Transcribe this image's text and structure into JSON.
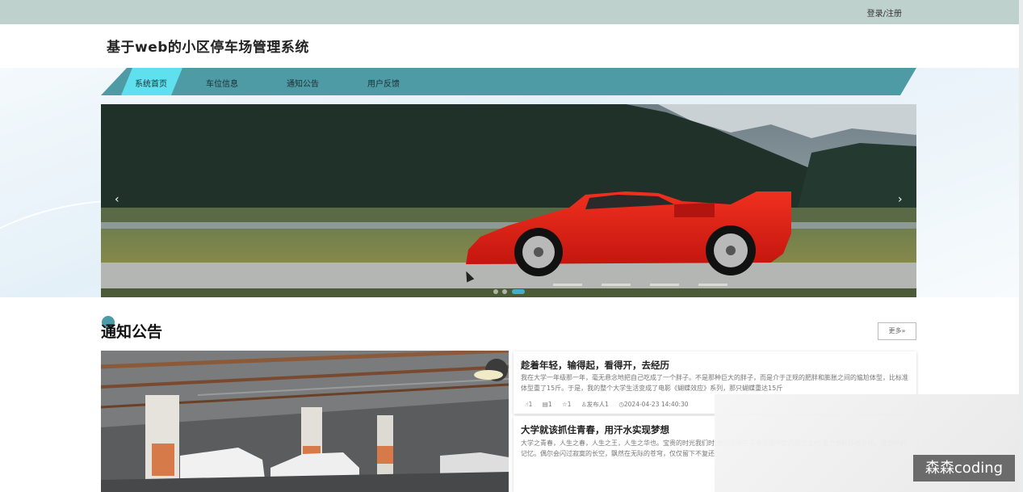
{
  "header": {
    "login_label": "登录/注册",
    "site_title": "基于web的小区停车场管理系统"
  },
  "nav": {
    "items": [
      {
        "label": "系统首页",
        "active": true
      },
      {
        "label": "车位信息",
        "active": false
      },
      {
        "label": "通知公告",
        "active": false
      },
      {
        "label": "用户反馈",
        "active": false
      }
    ]
  },
  "banner": {
    "prev_arrow": "‹",
    "next_arrow": "›",
    "slide_count": 3,
    "active_slide": 3
  },
  "notices": {
    "section_title": "通知公告",
    "more_label": "更多»",
    "items": [
      {
        "title": "趁着年轻，输得起，看得开，去经历",
        "body": "我在大学一年级那一年，毫无悬念地把自己吃成了一个胖子。不是那种巨大的胖子，而是介于正规的肥胖和膨胀之间的尴尬体型，比标准体型重了15斤。于是，我的整个大学生活变成了电影《蝴蝶效应》系列，那只蝴蝶重达15斤",
        "likes": "1",
        "comments": "1",
        "favorites": "1",
        "publisher": "发布人1",
        "time": "2024-04-23 14:40:30"
      },
      {
        "title": "大学就该抓住青春，用汗水实现梦想",
        "body": "大学之青春，人生之春，人生之王，人生之华也。宝贵的时光我们时;依旧游离在青春摇摆不定的尾巴上时;奋力想抓却抓不住。用力碎的记忆。偶尔会闪过寂寞的长空，飘然在无际的苍穹，仅仅留下不复还",
        "likes": "",
        "comments": "",
        "favorites": "",
        "publisher": "",
        "time": ""
      }
    ]
  },
  "overlay": {
    "watermark": "森森coding"
  },
  "colors": {
    "topbar": "#bfd1cd",
    "nav": "#4e9aa5",
    "nav_active": "#5ee0ee",
    "car": "#e8231c"
  }
}
